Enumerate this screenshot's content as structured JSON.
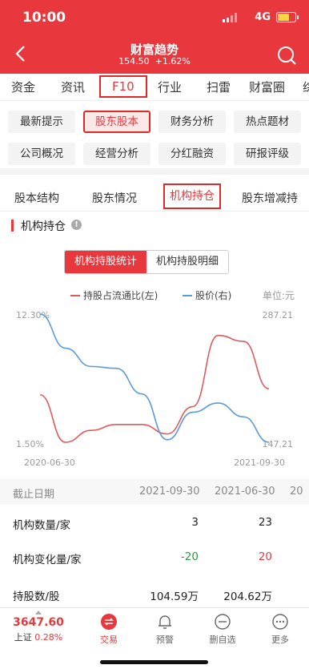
{
  "status": {
    "time": "10:00",
    "network": "4G"
  },
  "nav": {
    "title": "财富趋势",
    "price": "154.50",
    "change": "+1.62%"
  },
  "top_tabs": [
    "资金",
    "资讯",
    "F10",
    "行业",
    "扫雷",
    "财富圈",
    "综"
  ],
  "top_tab_active": "F10",
  "f10_chips": [
    "最新提示",
    "股东股本",
    "财务分析",
    "热点题材",
    "公司概况",
    "经营分析",
    "分红融资",
    "研报评级"
  ],
  "f10_chip_active": "股东股本",
  "sub_tabs": [
    "股本结构",
    "股东情况",
    "机构持仓",
    "股东增减持"
  ],
  "sub_tab_active": "机构持仓",
  "section_title": "机构持仓",
  "segment": {
    "active": "机构持股统计",
    "other": "机构持股明细"
  },
  "legend": {
    "series1": "持股占流通比(左)",
    "series2": "股价(右)",
    "unit": "单位:元",
    "color1": "#e05a5a",
    "color2": "#5a9ad8"
  },
  "chart_data": {
    "type": "line",
    "x_labels": [
      "2020-06-30",
      "2021-09-30"
    ],
    "y_left_labels": [
      "12.30%",
      "1.50%"
    ],
    "y_right_labels": [
      "287.21",
      "147.21"
    ],
    "series": [
      {
        "name": "持股占流通比(左)",
        "values": [
          5.5,
          1.5,
          2.5,
          3.0,
          3.0,
          2.2,
          4.5,
          10.5,
          10.0,
          6.0
        ]
      },
      {
        "name": "股价(右)",
        "values": [
          287.21,
          250,
          230,
          228,
          200,
          150,
          180,
          190,
          175,
          147.21
        ]
      }
    ],
    "ylim_left": [
      1.5,
      12.3
    ],
    "ylim_right": [
      147.21,
      287.21
    ]
  },
  "table": {
    "header": [
      "截止日期",
      "2021-09-30",
      "2021-06-30",
      "20"
    ],
    "rows": [
      {
        "label": "机构数量/家",
        "v1": "3",
        "v2": "23",
        "c1": "#222",
        "c2": "#222"
      },
      {
        "label": "机构变化量/家",
        "v1": "-20",
        "v2": "20",
        "c1": "#2a9a3a",
        "c2": "#e8383d"
      },
      {
        "label": "持股数/股",
        "v1": "104.59万",
        "v2": "204.62万",
        "c1": "#222",
        "c2": "#222"
      }
    ]
  },
  "bottom": {
    "index_value": "3647.60",
    "index_label": "上证",
    "index_change": "0.28%",
    "items": [
      "交易",
      "预警",
      "删自选",
      "更多"
    ]
  }
}
